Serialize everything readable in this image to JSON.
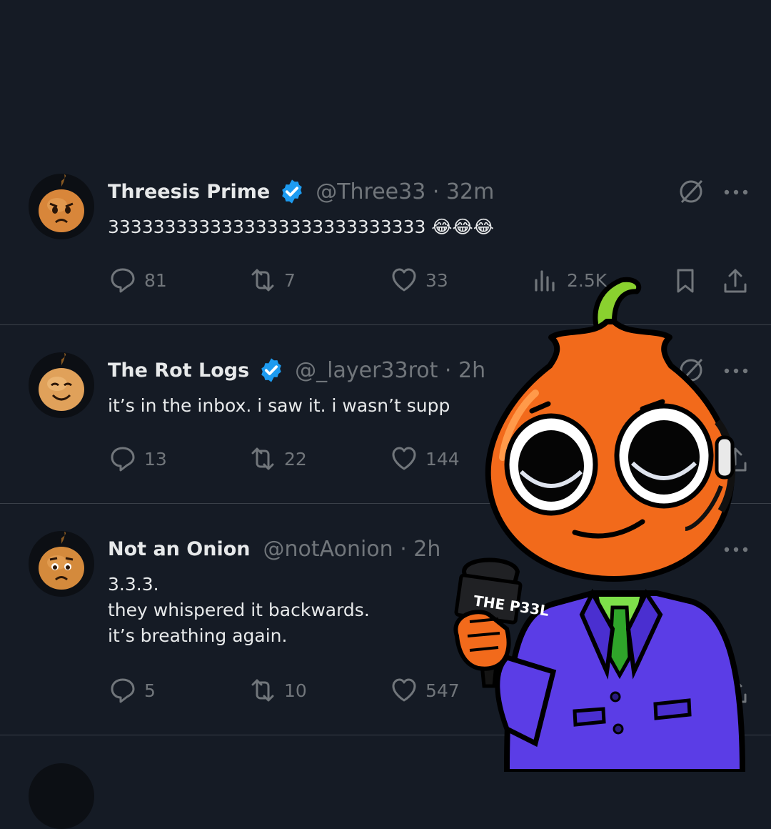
{
  "tweets": [
    {
      "name": "Threesis Prime",
      "verified": true,
      "handle_time": "@Three33 · 32m",
      "text": "3333333333333333333333333333 😂😂😂",
      "avatar_icon": "angry-onion-avatar",
      "replies": "81",
      "reposts": "7",
      "likes": "33",
      "views": "2.5K"
    },
    {
      "name": "The Rot Logs",
      "verified": true,
      "handle_time": "@_layer33rot · 2h",
      "text": "it’s in the inbox. i saw it. i wasn’t supp",
      "avatar_icon": "smiling-onion-avatar",
      "replies": "13",
      "reposts": "22",
      "likes": "144"
    },
    {
      "name": "Not an Onion",
      "verified": false,
      "handle_time": "@notAonion · 2h",
      "text": "3.3.3.\nthey whispered it backwards.\nit’s breathing again.",
      "avatar_icon": "worried-onion-avatar",
      "replies": "5",
      "reposts": "10",
      "likes": "547"
    }
  ],
  "overlay": {
    "microphone_label": "THE P33L",
    "mascot_icon": "onion-reporter-mascot"
  },
  "colors": {
    "background": "#151b25",
    "divider": "#3a4049",
    "muted_text": "#71767b",
    "verified_blue": "#1d9bf0",
    "mascot_orange": "#f26a1b",
    "suit_purple": "#5b3de6"
  }
}
